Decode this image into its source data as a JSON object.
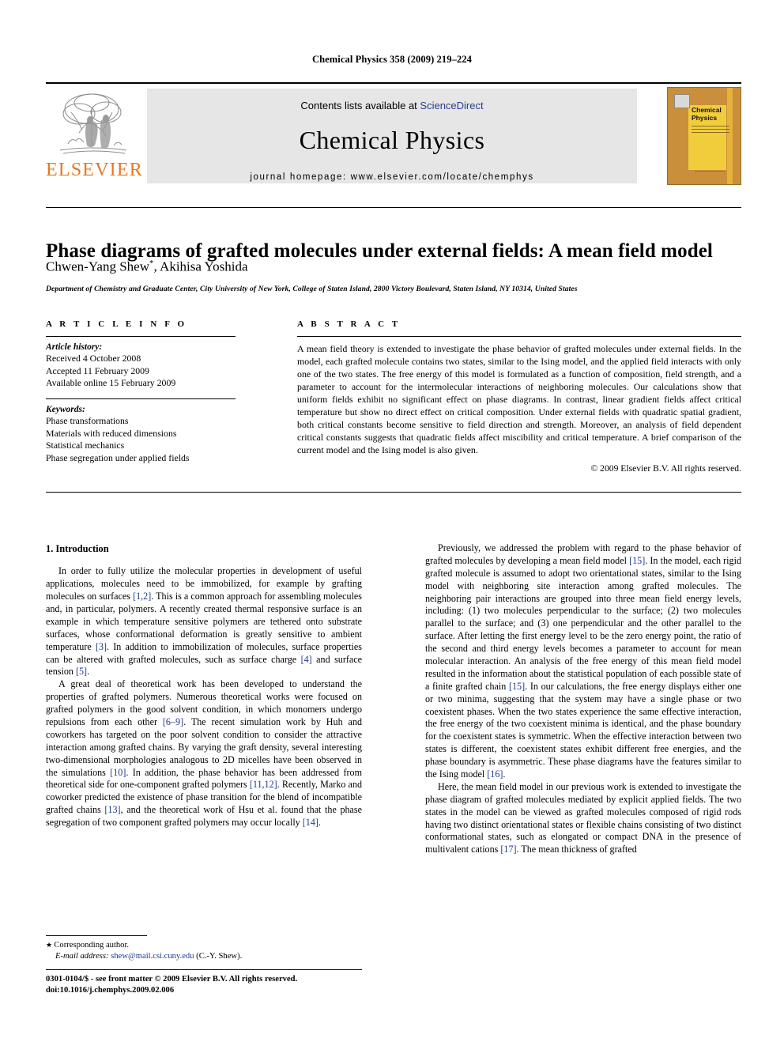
{
  "running_head": "Chemical Physics 358 (2009) 219–224",
  "masthead": {
    "publisher_name": "ELSEVIER",
    "contents_prefix": "Contents lists available at ",
    "contents_link": "ScienceDirect",
    "journal_title": "Chemical Physics",
    "homepage": "journal homepage: www.elsevier.com/locate/chemphys",
    "cover_title": "Chemical\nPhysics"
  },
  "article": {
    "title": "Phase diagrams of grafted molecules under external fields: A mean field model",
    "authors": "Chwen-Yang Shew",
    "corresponding_marker": "*",
    "authors_tail": ", Akihisa Yoshida",
    "affiliation": "Department of Chemistry and Graduate Center, City University of New York, College of Staten Island, 2800 Victory Boulevard, Staten Island, NY 10314, United States"
  },
  "info": {
    "heading": "A R T I C L E   I N F O",
    "history_label": "Article history:",
    "history": [
      "Received 4 October 2008",
      "Accepted 11 February 2009",
      "Available online 15 February 2009"
    ],
    "keywords_label": "Keywords:",
    "keywords": [
      "Phase transformations",
      "Materials with reduced dimensions",
      "Statistical mechanics",
      "Phase segregation under applied fields"
    ]
  },
  "abstract": {
    "heading": "A B S T R A C T",
    "text": "A mean field theory is extended to investigate the phase behavior of grafted molecules under external fields. In the model, each grafted molecule contains two states, similar to the Ising model, and the applied field interacts with only one of the two states. The free energy of this model is formulated as a function of composition, field strength, and a parameter to account for the intermolecular interactions of neighboring molecules. Our calculations show that uniform fields exhibit no significant effect on phase diagrams. In contrast, linear gradient fields affect critical temperature but show no direct effect on critical composition. Under external fields with quadratic spatial gradient, both critical constants become sensitive to field direction and strength. Moreover, an analysis of field dependent critical constants suggests that quadratic fields affect miscibility and critical temperature. A brief comparison of the current model and the Ising model is also given.",
    "copyright": "© 2009 Elsevier B.V. All rights reserved."
  },
  "body": {
    "section_heading": "1. Introduction",
    "left_p1_a": "In order to fully utilize the molecular properties in development of useful applications, molecules need to be immobilized, for example by grafting molecules on surfaces ",
    "left_p1_r1": "[1,2]",
    "left_p1_b": ". This is a common approach for assembling molecules and, in particular, polymers. A recently created thermal responsive surface is an example in which temperature sensitive polymers are tethered onto substrate surfaces, whose conformational deformation is greatly sensitive to ambient temperature ",
    "left_p1_r2": "[3]",
    "left_p1_c": ". In addition to immobilization of molecules, surface properties can be altered with grafted molecules, such as surface charge ",
    "left_p1_r3": "[4]",
    "left_p1_d": " and surface tension ",
    "left_p1_r4": "[5]",
    "left_p1_e": ".",
    "left_p2_a": "A great deal of theoretical work has been developed to understand the properties of grafted polymers. Numerous theoretical works were focused on grafted polymers in the good solvent condition, in which monomers undergo repulsions from each other ",
    "left_p2_r1": "[6–9]",
    "left_p2_b": ". The recent simulation work by Huh and coworkers has targeted on the poor solvent condition to consider the attractive interaction among grafted chains. By varying the graft density, several interesting two-dimensional morphologies analogous to 2D micelles have been observed in the simulations ",
    "left_p2_r2": "[10]",
    "left_p2_c": ". In addition, the phase behavior has been addressed from theoretical side for one-component grafted polymers ",
    "left_p2_r3": "[11,12]",
    "left_p2_d": ". Recently, Marko and coworker predicted the existence of phase transition for the blend of incompatible grafted chains ",
    "left_p2_r4": "[13]",
    "left_p2_e": ", and the theoretical work of Hsu et al. found that the phase segregation of two component grafted polymers may occur locally ",
    "left_p2_r5": "[14]",
    "left_p2_f": ".",
    "right_p1_a": "Previously, we addressed the problem with regard to the phase behavior of grafted molecules by developing a mean field model ",
    "right_p1_r1": "[15]",
    "right_p1_b": ". In the model, each rigid grafted molecule is assumed to adopt two orientational states, similar to the Ising model with neighboring site interaction among grafted molecules. The neighboring pair interactions are grouped into three mean field energy levels, including: (1) two molecules perpendicular to the surface; (2) two molecules parallel to the surface; and (3) one perpendicular and the other parallel to the surface. After letting the first energy level to be the zero energy point, the ratio of the second and third energy levels becomes a parameter to account for mean molecular interaction. An analysis of the free energy of this mean field model resulted in the information about the statistical population of each possible state of a finite grafted chain ",
    "right_p1_r2": "[15]",
    "right_p1_c": ". In our calculations, the free energy displays either one or two minima, suggesting that the system may have a single phase or two coexistent phases. When the two states experience the same effective interaction, the free energy of the two coexistent minima is identical, and the phase boundary for the coexistent states is symmetric. When the effective interaction between two states is different, the coexistent states exhibit different free energies, and the phase boundary is asymmetric. These phase diagrams have the features similar to the Ising model ",
    "right_p1_r3": "[16]",
    "right_p1_d": ".",
    "right_p2_a": "Here, the mean field model in our previous work is extended to investigate the phase diagram of grafted molecules mediated by explicit applied fields. The two states in the model can be viewed as grafted molecules composed of rigid rods having two distinct orientational states or flexible chains consisting of two distinct conformational states, such as elongated or compact DNA in the presence of multivalent cations ",
    "right_p2_r1": "[17]",
    "right_p2_b": ". The mean thickness of grafted"
  },
  "footnote": {
    "corresponding": "Corresponding author.",
    "email_label": "E-mail address:",
    "email": "shew@mail.csi.cuny.edu",
    "email_suffix": " (C.-Y. Shew)."
  },
  "footer": {
    "issn_line": "0301-0104/$ - see front matter © 2009 Elsevier B.V. All rights reserved.",
    "doi_line": "doi:10.1016/j.chemphys.2009.02.006"
  },
  "colors": {
    "elsevier_orange": "#E87722",
    "link_blue": "#2b3c8f",
    "reference_blue": "#1b3a8c",
    "banner_grey": "#e6e6e6"
  }
}
